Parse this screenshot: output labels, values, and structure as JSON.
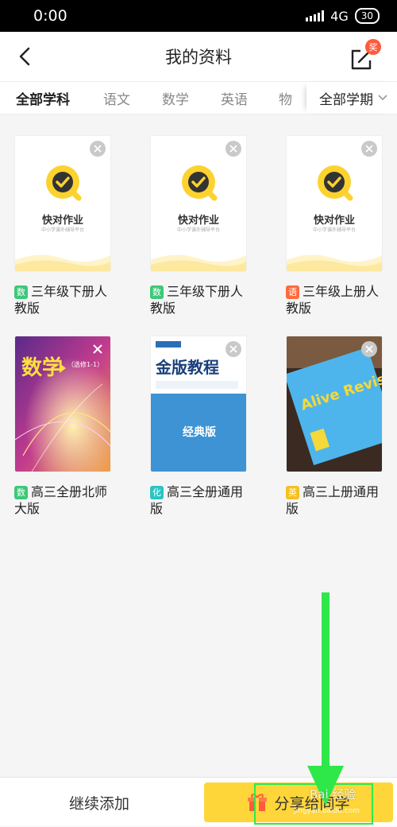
{
  "status": {
    "time": "0:00",
    "network": "4G",
    "battery": "30"
  },
  "header": {
    "title": "我的资料",
    "badge": "奖"
  },
  "tabs": [
    {
      "label": "全部学科",
      "active": true
    },
    {
      "label": "语文",
      "active": false
    },
    {
      "label": "数学",
      "active": false
    },
    {
      "label": "英语",
      "active": false
    },
    {
      "label": "物",
      "active": false
    }
  ],
  "term_filter": "全部学期",
  "brand": {
    "name": "快对作业",
    "sub": "中小学课外辅导平台"
  },
  "items": [
    {
      "tag": "数",
      "tag_color": "#3cc878",
      "title": "三年级下册人教版",
      "cover": "placeholder"
    },
    {
      "tag": "数",
      "tag_color": "#3cc878",
      "title": "三年级下册人教版",
      "cover": "placeholder"
    },
    {
      "tag": "语",
      "tag_color": "#ff6a3d",
      "title": "三年级上册人教版",
      "cover": "placeholder"
    },
    {
      "tag": "数",
      "tag_color": "#3cc878",
      "title": "高三全册北师大版",
      "cover": "math-book",
      "cover_text": "数学",
      "cover_sub": "（选修1-1）"
    },
    {
      "tag": "化",
      "tag_color": "#2bc3c3",
      "title": "高三全册通用版",
      "cover": "jinban-book",
      "cover_text": "金版教程",
      "cover_sub": "经典版"
    },
    {
      "tag": "英",
      "tag_color": "#f5c020",
      "title": "高三上册通用版",
      "cover": "english-book",
      "cover_text": "Alive Revise"
    }
  ],
  "bottom": {
    "add_label": "继续添加",
    "share_label": "分享给同学"
  },
  "watermark": {
    "main": "Bai 经验",
    "url": "jingyan.baidu.com"
  }
}
